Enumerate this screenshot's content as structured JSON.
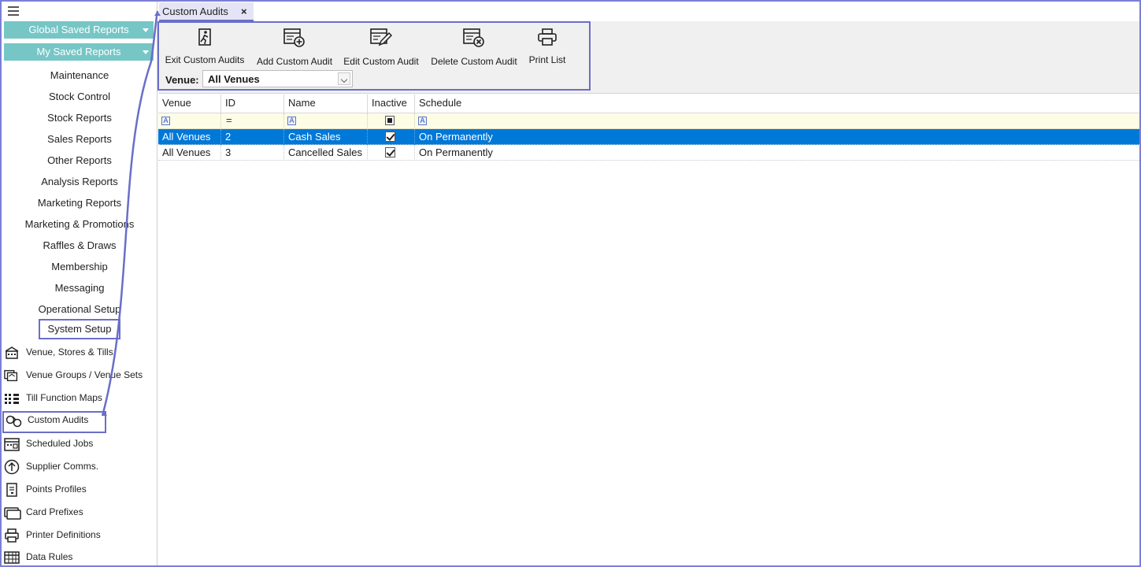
{
  "sidebar": {
    "global_saved_reports": "Global Saved Reports",
    "my_saved_reports": "My Saved Reports",
    "menu_items": [
      "Maintenance",
      "Stock Control",
      "Stock Reports",
      "Sales Reports",
      "Other Reports",
      "Analysis Reports",
      "Marketing Reports",
      "Marketing & Promotions",
      "Raffles & Draws",
      "Membership",
      "Messaging",
      "Operational Setup",
      "System Setup"
    ],
    "sub_items": [
      {
        "label": "Venue, Stores & Tills",
        "icon": "venue-stores-icon"
      },
      {
        "label": "Venue Groups / Venue Sets",
        "icon": "venue-groups-icon"
      },
      {
        "label": "Till Function Maps",
        "icon": "grid-map-icon"
      },
      {
        "label": "Custom Audits",
        "icon": "custom-audits-icon"
      },
      {
        "label": "Scheduled Jobs",
        "icon": "calendar-icon"
      },
      {
        "label": "Supplier Comms.",
        "icon": "upload-circle-icon"
      },
      {
        "label": "Points Profiles",
        "icon": "document-icon"
      },
      {
        "label": "Card Prefixes",
        "icon": "card-icon"
      },
      {
        "label": "Printer Definitions",
        "icon": "printer-icon"
      },
      {
        "label": "Data Rules",
        "icon": "table-icon"
      }
    ]
  },
  "tab": {
    "label": "Custom Audits",
    "close": "×"
  },
  "toolbar": {
    "exit": "Exit Custom Audits",
    "add": "Add Custom Audit",
    "edit": "Edit Custom Audit",
    "delete": "Delete Custom Audit",
    "print": "Print List",
    "venue_label": "Venue:",
    "venue_value": "All Venues"
  },
  "grid": {
    "columns": [
      "Venue",
      "ID",
      "Name",
      "Inactive",
      "Schedule"
    ],
    "filter": {
      "a": "A",
      "eq": "="
    },
    "rows": [
      {
        "venue": "All Venues",
        "id": "2",
        "name": "Cash Sales",
        "schedule": "On Permanently",
        "checked": true
      },
      {
        "venue": "All Venues",
        "id": "3",
        "name": "Cancelled Sales",
        "schedule": "On Permanently",
        "checked": true
      }
    ]
  },
  "colors": {
    "accent": "#6a6ec9",
    "teal": "#76c6c6",
    "selection": "#0078d7",
    "filter_bg": "#fdfde6"
  }
}
